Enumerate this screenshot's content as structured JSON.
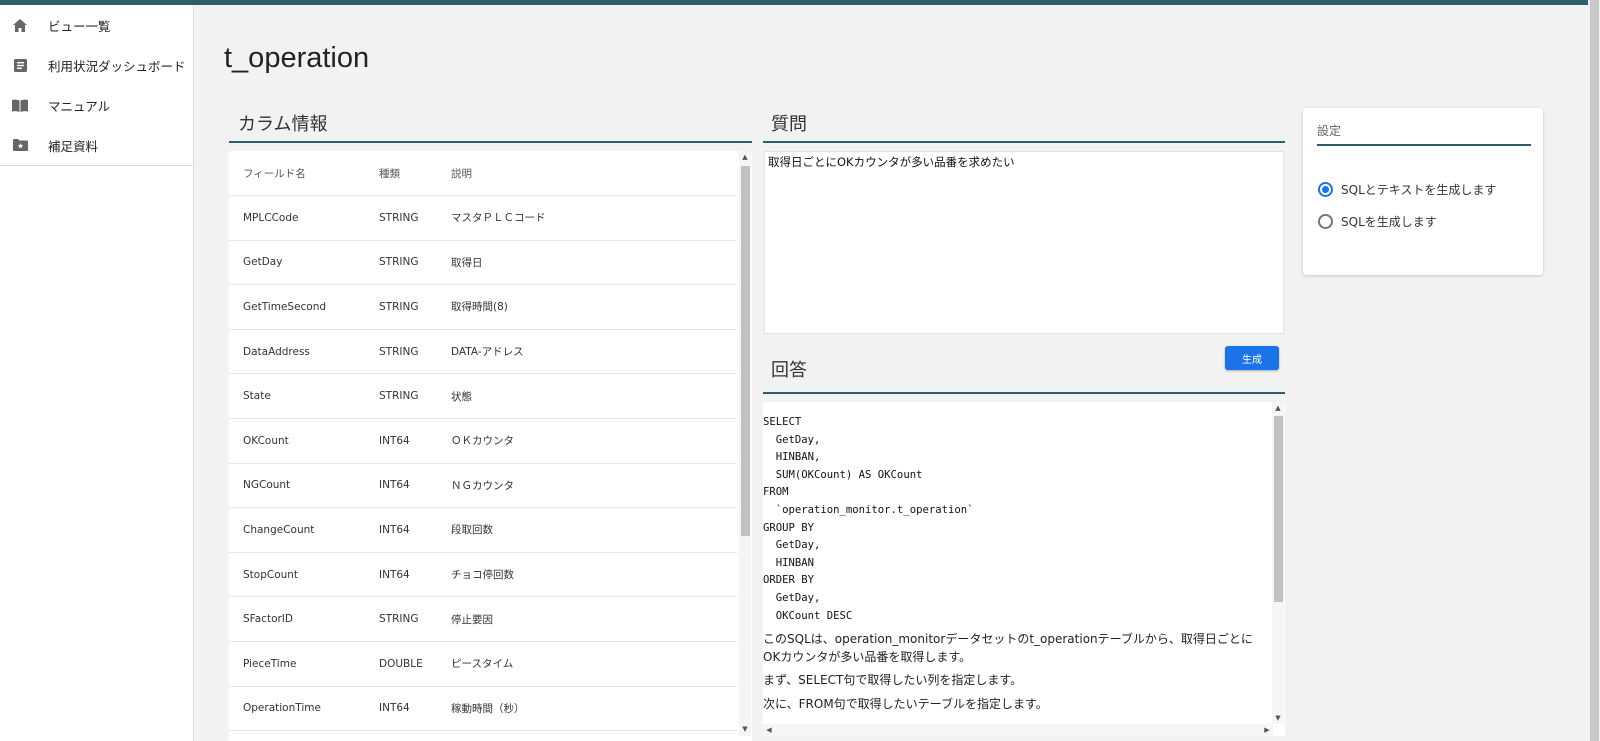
{
  "sidebar": {
    "items": [
      {
        "label": "ビュー一覧",
        "icon": "home-icon"
      },
      {
        "label": "利用状況ダッシュボード",
        "icon": "document-icon"
      },
      {
        "label": "マニュアル",
        "icon": "book-icon"
      },
      {
        "label": "補足資料",
        "icon": "folder-star-icon"
      }
    ]
  },
  "page": {
    "title": "t_operation"
  },
  "columns": {
    "heading": "カラム情報",
    "headers": {
      "field": "フィールド名",
      "type": "種類",
      "desc": "説明"
    },
    "rows": [
      {
        "field": "MPLCCode",
        "type": "STRING",
        "desc": "マスタＰＬＣコード"
      },
      {
        "field": "GetDay",
        "type": "STRING",
        "desc": "取得日"
      },
      {
        "field": "GetTimeSecond",
        "type": "STRING",
        "desc": "取得時間(8)"
      },
      {
        "field": "DataAddress",
        "type": "STRING",
        "desc": "DATA-アドレス"
      },
      {
        "field": "State",
        "type": "STRING",
        "desc": "状態"
      },
      {
        "field": "OKCount",
        "type": "INT64",
        "desc": "ＯＫカウンタ"
      },
      {
        "field": "NGCount",
        "type": "INT64",
        "desc": "ＮＧカウンタ"
      },
      {
        "field": "ChangeCount",
        "type": "INT64",
        "desc": "段取回数"
      },
      {
        "field": "StopCount",
        "type": "INT64",
        "desc": "チョコ停回数"
      },
      {
        "field": "SFactorID",
        "type": "STRING",
        "desc": "停止要因"
      },
      {
        "field": "PieceTime",
        "type": "DOUBLE",
        "desc": "ピースタイム"
      },
      {
        "field": "OperationTime",
        "type": "INT64",
        "desc": "稼動時間（秒）"
      }
    ]
  },
  "question": {
    "heading": "質問",
    "value": "取得日ごとにOKカウンタが多い品番を求めたい"
  },
  "generate_button": {
    "label": "生成"
  },
  "answer": {
    "heading": "回答",
    "sql": "SELECT\n  GetDay,\n  HINBAN,\n  SUM(OKCount) AS OKCount\nFROM\n  `operation_monitor.t_operation`\nGROUP BY\n  GetDay,\n  HINBAN\nORDER BY\n  GetDay,\n  OKCount DESC",
    "paragraphs": [
      "このSQLは、operation_monitorデータセットのt_operationテーブルから、取得日ごとにOKカウンタが多い品番を取得します。",
      "まず、SELECT句で取得したい列を指定します。",
      "次に、FROM句で取得したいテーブルを指定します。"
    ]
  },
  "settings": {
    "title": "設定",
    "options": [
      {
        "label": "SQLとテキストを生成します",
        "selected": true
      },
      {
        "label": "SQLを生成します",
        "selected": false
      }
    ]
  },
  "colors": {
    "accent": "#2d5f6a",
    "button": "#1a73e8"
  }
}
